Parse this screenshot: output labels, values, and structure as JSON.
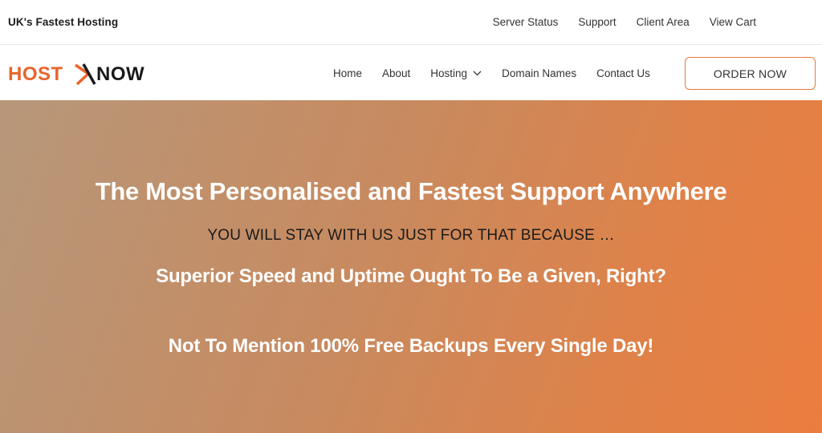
{
  "topbar": {
    "tagline": "UK's Fastest Hosting",
    "links": [
      "Server Status",
      "Support",
      "Client Area",
      "View Cart"
    ]
  },
  "brand": {
    "logo_text": "HOSTXNOW",
    "logo_left": "HOST",
    "logo_right": "NOW",
    "colors": {
      "orange": "#e8652a",
      "dark": "#1a1a1a"
    }
  },
  "nav": {
    "items": [
      "Home",
      "About",
      "Hosting",
      "Domain Names",
      "Contact Us"
    ],
    "order_button": "ORDER NOW"
  },
  "hero": {
    "headline": "The Most Personalised and Fastest Support Anywhere",
    "subheadline": "YOU WILL STAY WITH US JUST FOR THAT BECAUSE …",
    "line1": "Superior Speed and Uptime Ought To Be a Given, Right?",
    "line2": "Not To Mention 100% Free Backups Every Single Day!"
  },
  "theme": {
    "accent": "#e8793b"
  }
}
